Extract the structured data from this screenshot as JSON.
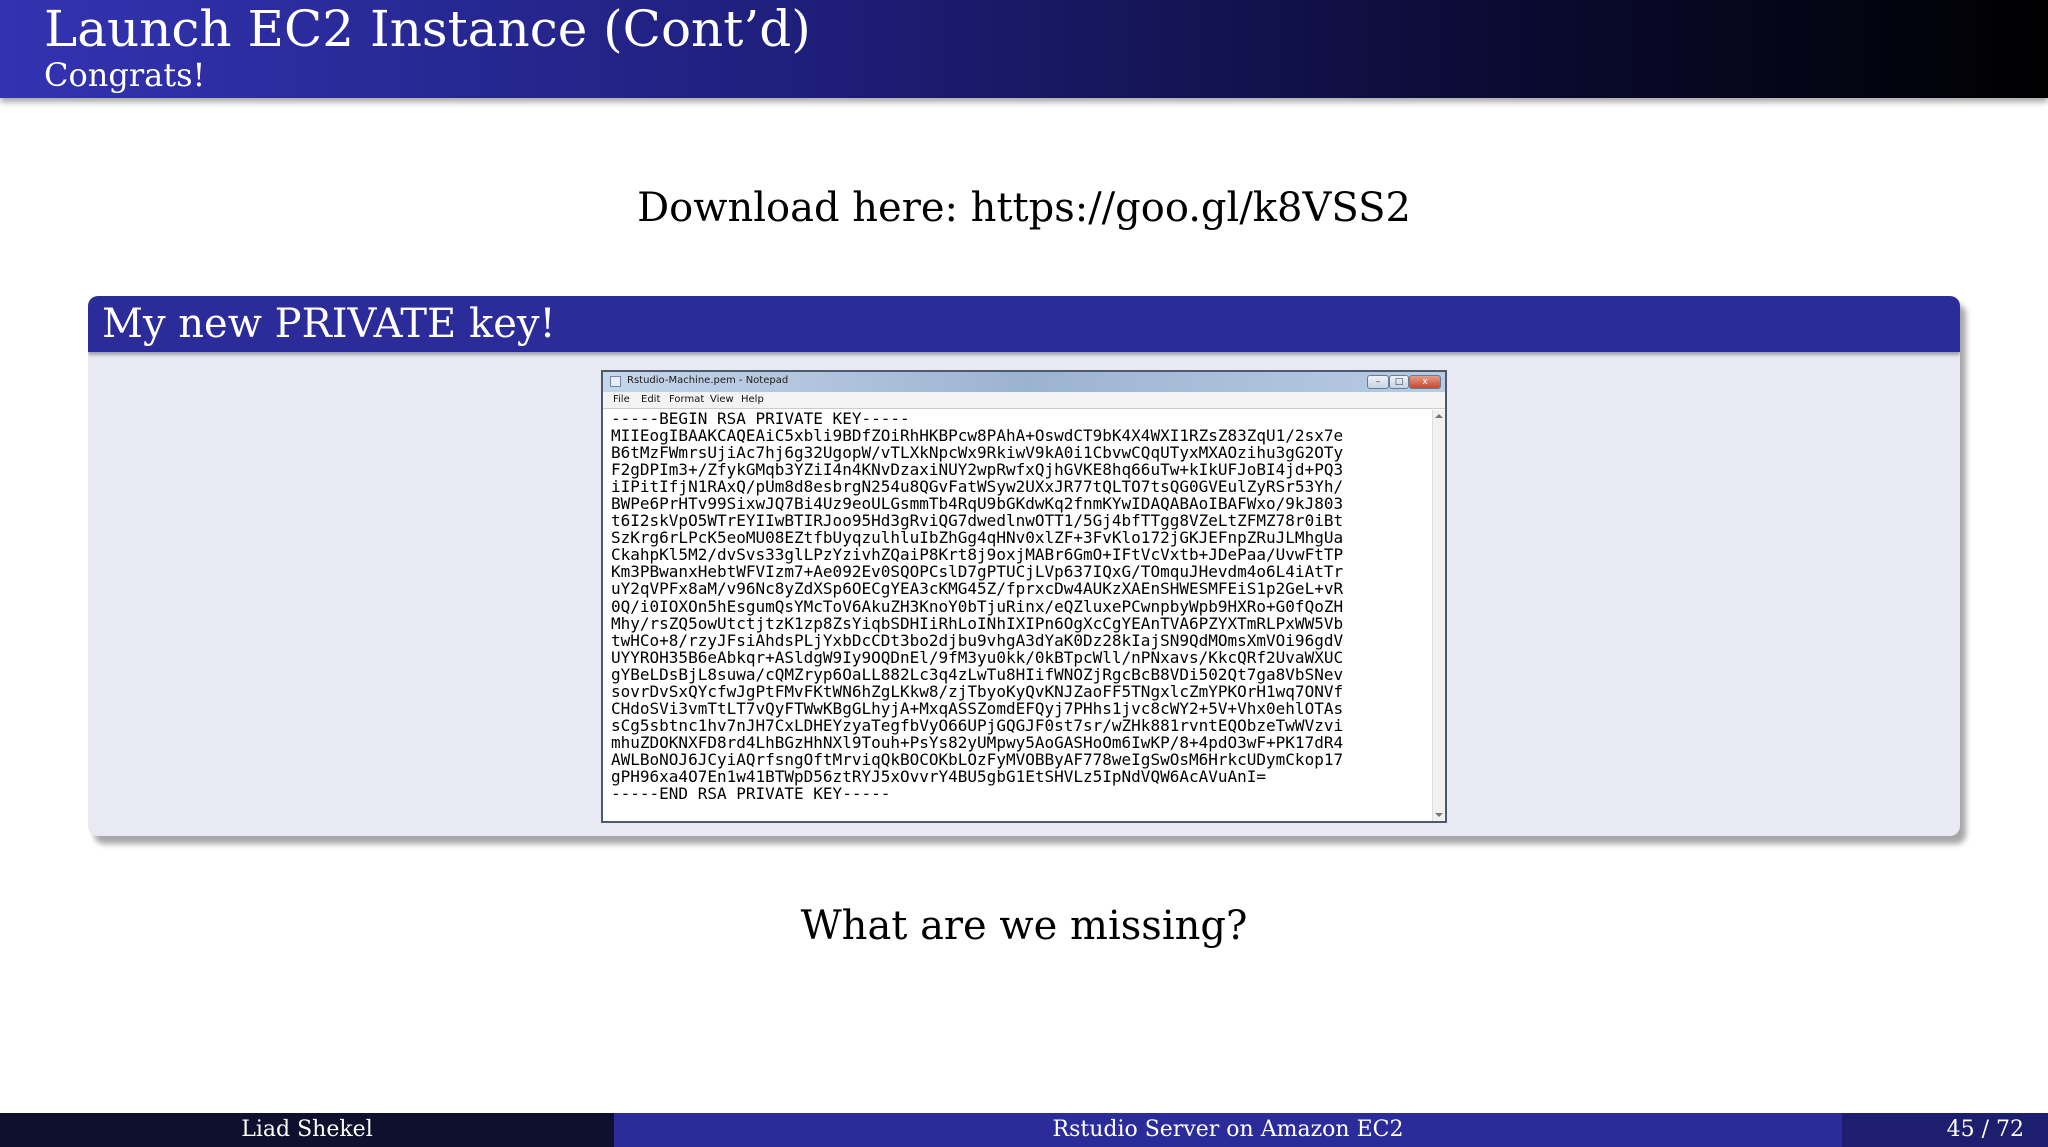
{
  "slide": {
    "title": "Launch EC2 Instance (Cont’d)",
    "subtitle": "Congrats!",
    "download_text": "Download here: https://goo.gl/k8VSS2",
    "block_title": "My new PRIVATE key!",
    "question": "What are we missing?"
  },
  "notepad": {
    "window_title": "Rstudio-Machine.pem - Notepad",
    "buttons": {
      "minimize": "–",
      "maximize": "□",
      "close": "x"
    },
    "menu": [
      "File",
      "Edit",
      "Format",
      "View",
      "Help"
    ],
    "lines": [
      "-----BEGIN RSA PRIVATE KEY-----",
      "MIIEogIBAAKCAQEAiC5xbli9BDfZOiRhHKBPcw8PAhA+OswdCT9bK4X4WXI1RZsZ83ZqU1/2sx7e",
      "B6tMzFWmrsUjiAc7hj6g32UgopW/vTLXkNpcWx9RkiwV9kA0i1CbvwCQqUTyxMXAOzihu3gG2OTy",
      "F2gDPIm3+/ZfykGMqb3YZiI4n4KNvDzaxiNUY2wpRwfxQjhGVKE8hq66uTw+kIkUFJoBI4jd+PQ3",
      "iIPitIfjN1RAxQ/pUm8d8esbrgN254u8QGvFatWSyw2UXxJR77tQLTO7tsQG0GVEulZyRSr53Yh/",
      "BWPe6PrHTv99SixwJQ7Bi4Uz9eoULGsmmTb4RqU9bGKdwKq2fnmKYwIDAQABAoIBAFWxo/9kJ803",
      "t6I2skVpO5WTrEYIIwBTIRJoo95Hd3gRviQG7dwedlnwOTT1/5Gj4bfTTgg8VZeLtZFMZ78r0iBt",
      "SzKrg6rLPcK5eoMU08EZtfbUyqzulhluIbZhGg4qHNv0xlZF+3FvKlo172jGKJEFnpZRuJLMhgUa",
      "CkahpKl5M2/dvSvs33glLPzYzivhZQaiP8Krt8j9oxjMABr6GmO+IFtVcVxtb+JDePaa/UvwFtTP",
      "Km3PBwanxHebtWFVIzm7+Ae092Ev0SQOPCslD7gPTUCjLVp637IQxG/TOmquJHevdm4o6L4iAtTr",
      "uY2qVPFx8aM/v96Nc8yZdXSp6OECgYEA3cKMG45Z/fprxcDw4AUKzXAEnSHWESMFEiS1p2GeL+vR",
      "0Q/i0IOXOn5hEsgumQsYMcToV6AkuZH3KnoY0bTjuRinx/eQZluxePCwnpbyWpb9HXRo+G0fQoZH",
      "Mhy/rsZQ5owUtctjtzK1zp8ZsYiqbSDHIiRhLoINhIXIPn6OgXcCgYEAnTVA6PZYXTmRLPxWW5Vb",
      "twHCo+8/rzyJFsiAhdsPLjYxbDcCDt3bo2djbu9vhgA3dYaK0Dz28kIajSN9QdMOmsXmVOi96gdV",
      "UYYROH35B6eAbkqr+ASldgW9Iy9OQDnEl/9fM3yu0kk/0kBTpcWll/nPNxavs/KkcQRf2UvaWXUC",
      "gYBeLDsBjL8suwa/cQMZryp6OaLL882Lc3q4zLwTu8HIifWNOZjRgcBcB8VDi502Qt7ga8VbSNev",
      "sovrDvSxQYcfwJgPtFMvFKtWN6hZgLKkw8/zjTbyoKyQvKNJZaoFF5TNgxlcZmYPKOrH1wq7ONVf",
      "CHdoSVi3vmTtLT7vQyFTWwKBgGLhyjA+MxqASSZomdEFQyj7PHhs1jvc8cWY2+5V+Vhx0ehlOTAs",
      "sCg5sbtnc1hv7nJH7CxLDHEYzyaTegfbVyO66UPjGQGJF0st7sr/wZHk881rvntEQObzeTwWVzvi",
      "mhuZDOKNXFD8rd4LhBGzHhNXl9Touh+PsYs82yUMpwy5AoGASHoOm6IwKP/8+4pdO3wF+PK17dR4",
      "AWLBoNOJ6JCyiAQrfsngOftMrviqQkBOCOKbLOzFyMVOBByAF778weIgSwOsM6HrkcUDymCkop17",
      "gPH96xa4O7En1w41BTWpD56ztRYJ5xOvvrY4BU5gbG1EtSHVLz5IpNdVQW6AcAVuAnI=",
      "-----END RSA PRIVATE KEY-----"
    ]
  },
  "footer": {
    "author": "Liad Shekel",
    "talk_title": "Rstudio Server on Amazon EC2",
    "page": "45 / 72"
  }
}
